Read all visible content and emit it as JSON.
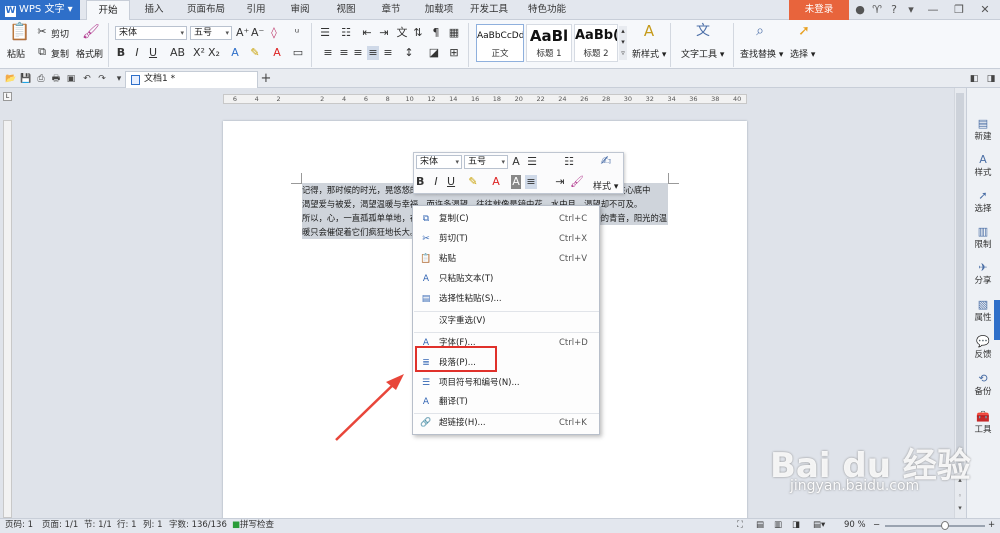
{
  "app": {
    "name": "WPS 文字",
    "logo": "W",
    "login": "未登录"
  },
  "menu": [
    "开始",
    "插入",
    "页面布局",
    "引用",
    "审阅",
    "视图",
    "章节",
    "加载项",
    "开发工具",
    "特色功能"
  ],
  "window_controls": [
    "shirt-icon",
    "help-icon",
    "menu-icon",
    "minimize-icon",
    "restore-icon",
    "close-icon"
  ],
  "ribbon": {
    "paste": "粘贴",
    "cut": "剪切",
    "copy": "复制",
    "format_painter": "格式刷",
    "font_name": "宋体",
    "font_size": "五号",
    "styles": [
      {
        "preview": "AaBbCcDd",
        "name": "正文"
      },
      {
        "preview": "AaBl",
        "name": "标题 1"
      },
      {
        "preview": "AaBb(",
        "name": "标题 2"
      }
    ],
    "new_style": "新样式",
    "text_tools": "文字工具",
    "find_replace": "查找替换",
    "select": "选择"
  },
  "doc_tab": {
    "title": "文档1 *"
  },
  "ruler": {
    "h_ticks": [
      "6",
      "4",
      "2",
      "",
      "2",
      "4",
      "6",
      "8",
      "10",
      "12",
      "14",
      "16",
      "18",
      "20",
      "22",
      "24",
      "26",
      "28",
      "30",
      "32",
      "34",
      "36",
      "38",
      "40"
    ]
  },
  "document": {
    "lines": [
      "记得，那时候的时光，晃悠悠的流过，阳光明媚的小路上，有我们的身影。于是，我们在心底中",
      "渴望爱与被爱，渴望温暖与幸福。而许多渴望，往往就像是镜中花，水中月，渴望却不可及。",
      "所以，心，一直孤孤单单地，在时光里流浪，流浪着那些遗失了的青春，那些逝去的青音，阳光的温",
      "暖只会催促着它们疯狂地长大。"
    ]
  },
  "minibar": {
    "font": "宋体",
    "size": "五号",
    "styles_label": "样式"
  },
  "context_menu": [
    {
      "icon": "copy-icon",
      "label": "复制(C)",
      "shortcut": "Ctrl+C"
    },
    {
      "icon": "cut-icon",
      "label": "剪切(T)",
      "shortcut": "Ctrl+X"
    },
    {
      "icon": "paste-icon",
      "label": "粘贴",
      "shortcut": "Ctrl+V"
    },
    {
      "icon": "paste-text-icon",
      "label": "只粘贴文本(T)",
      "shortcut": ""
    },
    {
      "icon": "paste-special-icon",
      "label": "选择性粘贴(S)...",
      "shortcut": ""
    },
    {
      "icon": "",
      "label": "汉字重选(V)",
      "shortcut": ""
    },
    {
      "icon": "font-icon",
      "label": "字体(F)...",
      "shortcut": "Ctrl+D"
    },
    {
      "icon": "paragraph-icon",
      "label": "段落(P)...",
      "shortcut": ""
    },
    {
      "icon": "bullets-icon",
      "label": "项目符号和编号(N)...",
      "shortcut": ""
    },
    {
      "icon": "translate-icon",
      "label": "翻译(T)",
      "shortcut": ""
    },
    {
      "icon": "hyperlink-icon",
      "label": "超链接(H)...",
      "shortcut": "Ctrl+K"
    }
  ],
  "right_panel": [
    {
      "icon": "new-icon",
      "label": "新建"
    },
    {
      "icon": "style-icon",
      "label": "样式"
    },
    {
      "icon": "select-icon",
      "label": "选择"
    },
    {
      "icon": "restrict-icon",
      "label": "限制"
    },
    {
      "icon": "share-icon",
      "label": "分享"
    },
    {
      "icon": "properties-icon",
      "label": "属性"
    },
    {
      "icon": "feedback-icon",
      "label": "反馈"
    },
    {
      "icon": "backup-icon",
      "label": "备份"
    },
    {
      "icon": "tools-icon",
      "label": "工具"
    }
  ],
  "status": {
    "page_num": "页码: 1",
    "pages": "页面: 1/1",
    "section": "节: 1/1",
    "row": "行: 1",
    "col": "列: 1",
    "words": "字数: 136/136",
    "spell": "拼写检查",
    "zoom": "90 %",
    "zoom_fraction": 0.6
  },
  "watermark": {
    "brand": "Bai du 经验",
    "url": "jingyan.baidu.com"
  },
  "colors": {
    "accent": "#2e6fc9",
    "login": "#e8643c",
    "highlight": "#e0312b",
    "arrow": "#e8463a"
  }
}
